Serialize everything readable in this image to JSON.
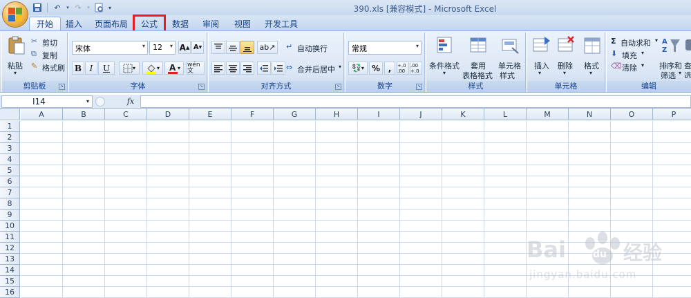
{
  "window": {
    "title": "390.xls  [兼容模式] - Microsoft Excel"
  },
  "tabs": [
    {
      "label": "开始",
      "active": true
    },
    {
      "label": "插入"
    },
    {
      "label": "页面布局"
    },
    {
      "label": "公式",
      "highlighted": true
    },
    {
      "label": "数据"
    },
    {
      "label": "审阅"
    },
    {
      "label": "视图"
    },
    {
      "label": "开发工具"
    }
  ],
  "ribbon": {
    "clipboard": {
      "paste": "粘贴",
      "cut": "剪切",
      "copy": "复制",
      "format_painter": "格式刷",
      "group": "剪贴板"
    },
    "font": {
      "name": "宋体",
      "size": "12",
      "bold": "B",
      "italic": "I",
      "underline": "U",
      "phonetic": "wén 文",
      "group": "字体"
    },
    "alignment": {
      "wrap": "自动换行",
      "merge": "合并后居中",
      "group": "对齐方式"
    },
    "number": {
      "format": "常规",
      "percent": "%",
      "comma": ",",
      "inc_decimal": "+.0 .00",
      "dec_decimal": ".00 +.0",
      "group": "数字"
    },
    "styles": {
      "conditional": "条件格式",
      "table_line1": "套用",
      "table_line2": "表格格式",
      "cell_line1": "单元格",
      "cell_line2": "样式",
      "group": "样式"
    },
    "cells": {
      "insert": "插入",
      "delete": "删除",
      "format": "格式",
      "group": "单元格"
    },
    "editing": {
      "autosum": "自动求和",
      "fill": "填充",
      "clear": "清除",
      "sort_line1": "排序和",
      "sort_line2": "筛选",
      "find_line1": "查",
      "find_line2": "选",
      "group": "编辑"
    }
  },
  "formula_bar": {
    "name_box": "I14",
    "fx": "fx",
    "value": ""
  },
  "columns": [
    "A",
    "B",
    "C",
    "D",
    "E",
    "F",
    "G",
    "H",
    "I",
    "J",
    "K",
    "L",
    "M",
    "N",
    "O",
    "P"
  ],
  "rows": [
    "1",
    "2",
    "3",
    "4",
    "5",
    "6",
    "7",
    "8",
    "9",
    "10",
    "11",
    "12",
    "13",
    "14",
    "15",
    "16"
  ],
  "watermark": {
    "brand": "Bai",
    "brand2": "du",
    "cn": "经验",
    "url": "jingyan.baidu.com"
  }
}
